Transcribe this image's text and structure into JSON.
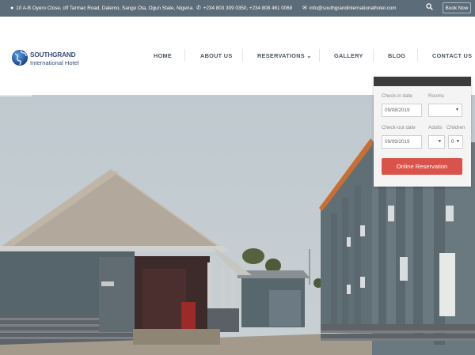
{
  "topbar": {
    "address": "10 A-B Oyero Close, off Tarmac Road, Dalemo, Sango Ota, Ogun State, Nigeria.",
    "phone": "+234 803 309 0350, +234 808 461 0068",
    "email": "info@southgrandinternationalhotel.com",
    "book_label": "Book Now"
  },
  "logo": {
    "title": "SOUTHGRAND",
    "subtitle": "International Hotel"
  },
  "nav": [
    {
      "label": "HOME"
    },
    {
      "label": "ABOUT US"
    },
    {
      "label": "RESERVATIONS ⌄"
    },
    {
      "label": "GALLERY"
    },
    {
      "label": "BLOG"
    },
    {
      "label": "CONTACT US"
    }
  ],
  "booking": {
    "checkin_label": "Check-in date",
    "checkin_value": "09/08/2019",
    "checkout_label": "Check-out date",
    "checkout_value": "09/09/2019",
    "rooms_label": "Rooms",
    "rooms_value": "",
    "adults_label": "Adults",
    "adults_value": "",
    "children_label": "Children",
    "children_value": "0",
    "button_label": "Online Reservation"
  },
  "colors": {
    "topbar": "#5c6c78",
    "accent": "#d9534a",
    "nav_text": "#4a5560"
  },
  "icons": [
    "map-marker-icon",
    "phone-icon",
    "envelope-icon",
    "search-icon",
    "uk-flag-icon",
    "globe-logo-icon"
  ]
}
